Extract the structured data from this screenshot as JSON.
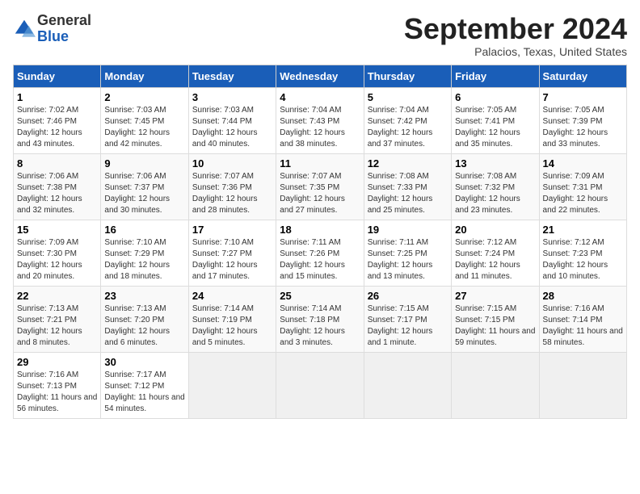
{
  "logo": {
    "general": "General",
    "blue": "Blue"
  },
  "title": "September 2024",
  "subtitle": "Palacios, Texas, United States",
  "days_of_week": [
    "Sunday",
    "Monday",
    "Tuesday",
    "Wednesday",
    "Thursday",
    "Friday",
    "Saturday"
  ],
  "weeks": [
    [
      {
        "day": "1",
        "sunrise": "7:02 AM",
        "sunset": "7:46 PM",
        "daylight": "12 hours and 43 minutes."
      },
      {
        "day": "2",
        "sunrise": "7:03 AM",
        "sunset": "7:45 PM",
        "daylight": "12 hours and 42 minutes."
      },
      {
        "day": "3",
        "sunrise": "7:03 AM",
        "sunset": "7:44 PM",
        "daylight": "12 hours and 40 minutes."
      },
      {
        "day": "4",
        "sunrise": "7:04 AM",
        "sunset": "7:43 PM",
        "daylight": "12 hours and 38 minutes."
      },
      {
        "day": "5",
        "sunrise": "7:04 AM",
        "sunset": "7:42 PM",
        "daylight": "12 hours and 37 minutes."
      },
      {
        "day": "6",
        "sunrise": "7:05 AM",
        "sunset": "7:41 PM",
        "daylight": "12 hours and 35 minutes."
      },
      {
        "day": "7",
        "sunrise": "7:05 AM",
        "sunset": "7:39 PM",
        "daylight": "12 hours and 33 minutes."
      }
    ],
    [
      {
        "day": "8",
        "sunrise": "7:06 AM",
        "sunset": "7:38 PM",
        "daylight": "12 hours and 32 minutes."
      },
      {
        "day": "9",
        "sunrise": "7:06 AM",
        "sunset": "7:37 PM",
        "daylight": "12 hours and 30 minutes."
      },
      {
        "day": "10",
        "sunrise": "7:07 AM",
        "sunset": "7:36 PM",
        "daylight": "12 hours and 28 minutes."
      },
      {
        "day": "11",
        "sunrise": "7:07 AM",
        "sunset": "7:35 PM",
        "daylight": "12 hours and 27 minutes."
      },
      {
        "day": "12",
        "sunrise": "7:08 AM",
        "sunset": "7:33 PM",
        "daylight": "12 hours and 25 minutes."
      },
      {
        "day": "13",
        "sunrise": "7:08 AM",
        "sunset": "7:32 PM",
        "daylight": "12 hours and 23 minutes."
      },
      {
        "day": "14",
        "sunrise": "7:09 AM",
        "sunset": "7:31 PM",
        "daylight": "12 hours and 22 minutes."
      }
    ],
    [
      {
        "day": "15",
        "sunrise": "7:09 AM",
        "sunset": "7:30 PM",
        "daylight": "12 hours and 20 minutes."
      },
      {
        "day": "16",
        "sunrise": "7:10 AM",
        "sunset": "7:29 PM",
        "daylight": "12 hours and 18 minutes."
      },
      {
        "day": "17",
        "sunrise": "7:10 AM",
        "sunset": "7:27 PM",
        "daylight": "12 hours and 17 minutes."
      },
      {
        "day": "18",
        "sunrise": "7:11 AM",
        "sunset": "7:26 PM",
        "daylight": "12 hours and 15 minutes."
      },
      {
        "day": "19",
        "sunrise": "7:11 AM",
        "sunset": "7:25 PM",
        "daylight": "12 hours and 13 minutes."
      },
      {
        "day": "20",
        "sunrise": "7:12 AM",
        "sunset": "7:24 PM",
        "daylight": "12 hours and 11 minutes."
      },
      {
        "day": "21",
        "sunrise": "7:12 AM",
        "sunset": "7:23 PM",
        "daylight": "12 hours and 10 minutes."
      }
    ],
    [
      {
        "day": "22",
        "sunrise": "7:13 AM",
        "sunset": "7:21 PM",
        "daylight": "12 hours and 8 minutes."
      },
      {
        "day": "23",
        "sunrise": "7:13 AM",
        "sunset": "7:20 PM",
        "daylight": "12 hours and 6 minutes."
      },
      {
        "day": "24",
        "sunrise": "7:14 AM",
        "sunset": "7:19 PM",
        "daylight": "12 hours and 5 minutes."
      },
      {
        "day": "25",
        "sunrise": "7:14 AM",
        "sunset": "7:18 PM",
        "daylight": "12 hours and 3 minutes."
      },
      {
        "day": "26",
        "sunrise": "7:15 AM",
        "sunset": "7:17 PM",
        "daylight": "12 hours and 1 minute."
      },
      {
        "day": "27",
        "sunrise": "7:15 AM",
        "sunset": "7:15 PM",
        "daylight": "11 hours and 59 minutes."
      },
      {
        "day": "28",
        "sunrise": "7:16 AM",
        "sunset": "7:14 PM",
        "daylight": "11 hours and 58 minutes."
      }
    ],
    [
      {
        "day": "29",
        "sunrise": "7:16 AM",
        "sunset": "7:13 PM",
        "daylight": "11 hours and 56 minutes."
      },
      {
        "day": "30",
        "sunrise": "7:17 AM",
        "sunset": "7:12 PM",
        "daylight": "11 hours and 54 minutes."
      },
      null,
      null,
      null,
      null,
      null
    ]
  ]
}
